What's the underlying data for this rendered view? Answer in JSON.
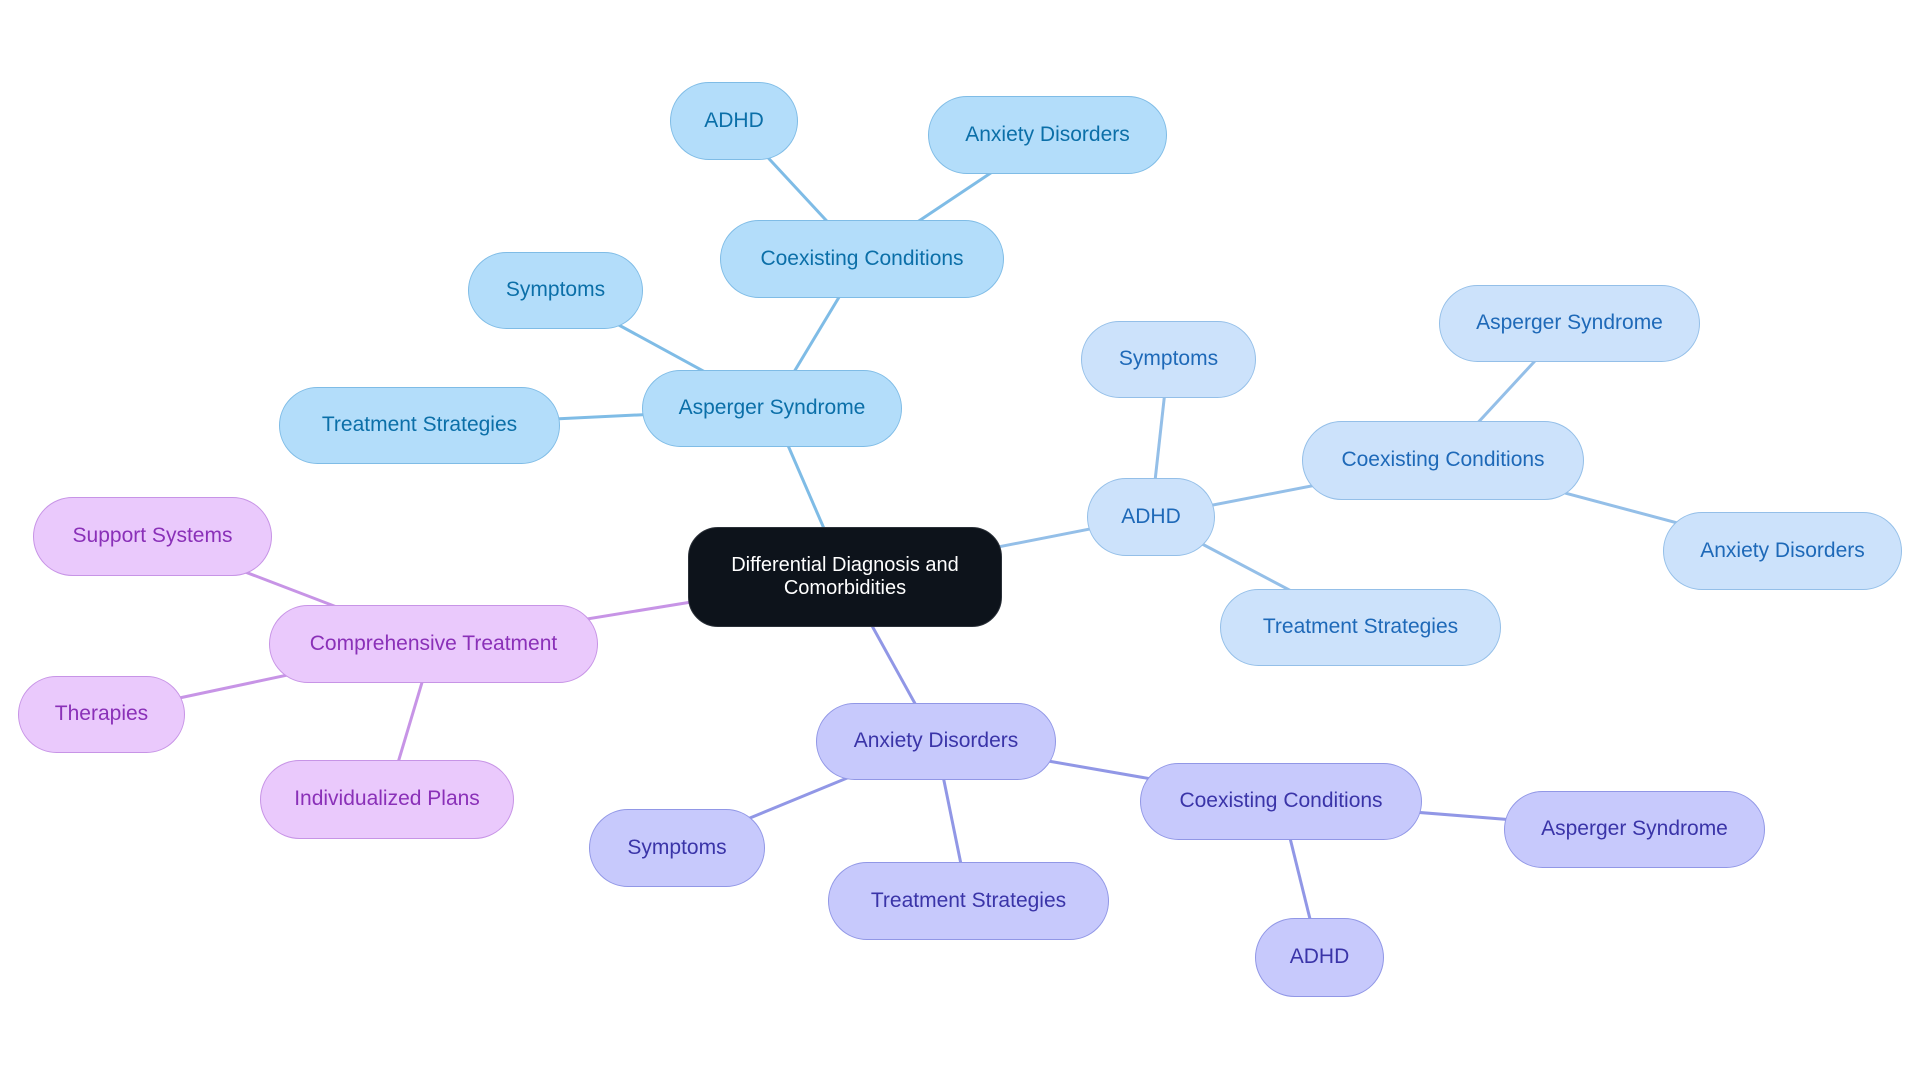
{
  "root": {
    "label": "Differential Diagnosis and Comorbidities"
  },
  "colors": {
    "asperger_branch": "#7fbce6",
    "adhd_branch": "#94bfe8",
    "anxiety_branch": "#9197e6",
    "treatment_branch": "#c794e6",
    "root_fill": "#0d131b"
  },
  "branches": {
    "asperger": {
      "label": "Asperger Syndrome",
      "symptoms": "Symptoms",
      "treatment": "Treatment Strategies",
      "coexisting": {
        "label": "Coexisting Conditions",
        "children": [
          "ADHD",
          "Anxiety Disorders"
        ]
      }
    },
    "adhd": {
      "label": "ADHD",
      "symptoms": "Symptoms",
      "treatment": "Treatment Strategies",
      "coexisting": {
        "label": "Coexisting Conditions",
        "children": [
          "Asperger Syndrome",
          "Anxiety Disorders"
        ]
      }
    },
    "anxiety": {
      "label": "Anxiety Disorders",
      "symptoms": "Symptoms",
      "treatment": "Treatment Strategies",
      "coexisting": {
        "label": "Coexisting Conditions",
        "children": [
          "Asperger Syndrome",
          "ADHD"
        ]
      }
    },
    "comprehensive": {
      "label": "Comprehensive Treatment",
      "children": [
        "Support Systems",
        "Therapies",
        "Individualized Plans"
      ]
    }
  }
}
